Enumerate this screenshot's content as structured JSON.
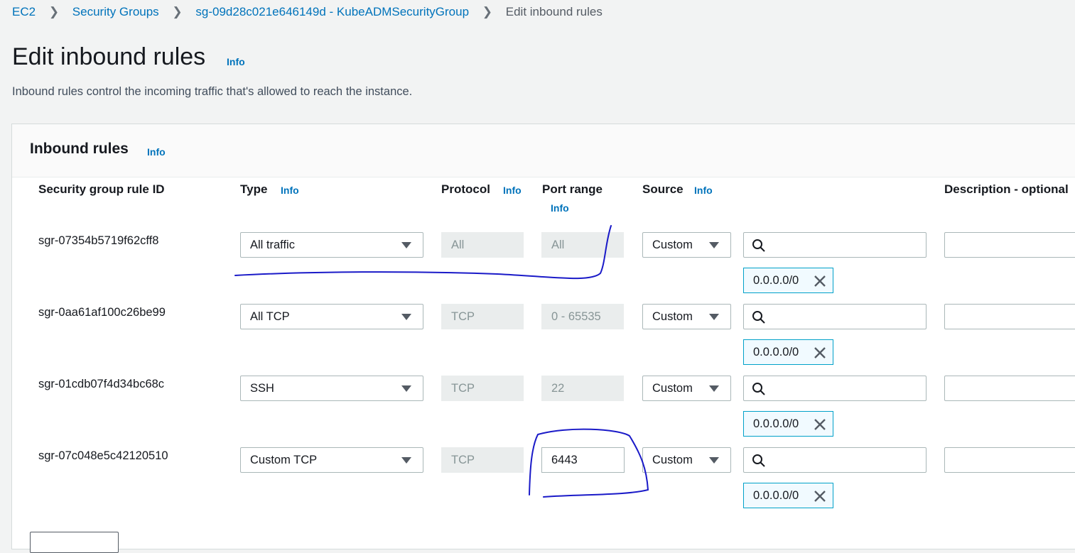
{
  "breadcrumb": [
    {
      "label": "EC2"
    },
    {
      "label": "Security Groups"
    },
    {
      "label": "sg-09d28c021e646149d - KubeADMSecurityGroup"
    },
    {
      "label": "Edit inbound rules"
    }
  ],
  "page": {
    "title": "Edit inbound rules",
    "info": "Info",
    "description": "Inbound rules control the incoming traffic that's allowed to reach the instance."
  },
  "panel": {
    "title": "Inbound rules",
    "info": "Info",
    "columns": {
      "rule_id": "Security group rule ID",
      "type": "Type",
      "protocol": "Protocol",
      "port_range": "Port range",
      "source": "Source",
      "description": "Description - optional",
      "info": "Info"
    },
    "rules": [
      {
        "id": "sgr-07354b5719f62cff8",
        "type": "All traffic",
        "protocol": "All",
        "port_range": "All",
        "source": "Custom",
        "cidr": "0.0.0.0/0"
      },
      {
        "id": "sgr-0aa61af100c26be99",
        "type": "All TCP",
        "protocol": "TCP",
        "port_range": "0 - 65535",
        "source": "Custom",
        "cidr": "0.0.0.0/0"
      },
      {
        "id": "sgr-01cdb07f4d34bc68c",
        "type": "SSH",
        "protocol": "TCP",
        "port_range": "22",
        "source": "Custom",
        "cidr": "0.0.0.0/0"
      },
      {
        "id": "sgr-07c048e5c42120510",
        "type": "Custom TCP",
        "protocol": "TCP",
        "port_range": "6443",
        "source": "Custom",
        "cidr": "0.0.0.0/0"
      }
    ]
  },
  "colors": {
    "link": "#0073bb",
    "annotation_ink": "#1a1ac8",
    "token_border": "#00a1c9"
  },
  "icons": {
    "search": "search-icon",
    "remove": "close-icon",
    "dropdown": "caret-down-icon"
  }
}
